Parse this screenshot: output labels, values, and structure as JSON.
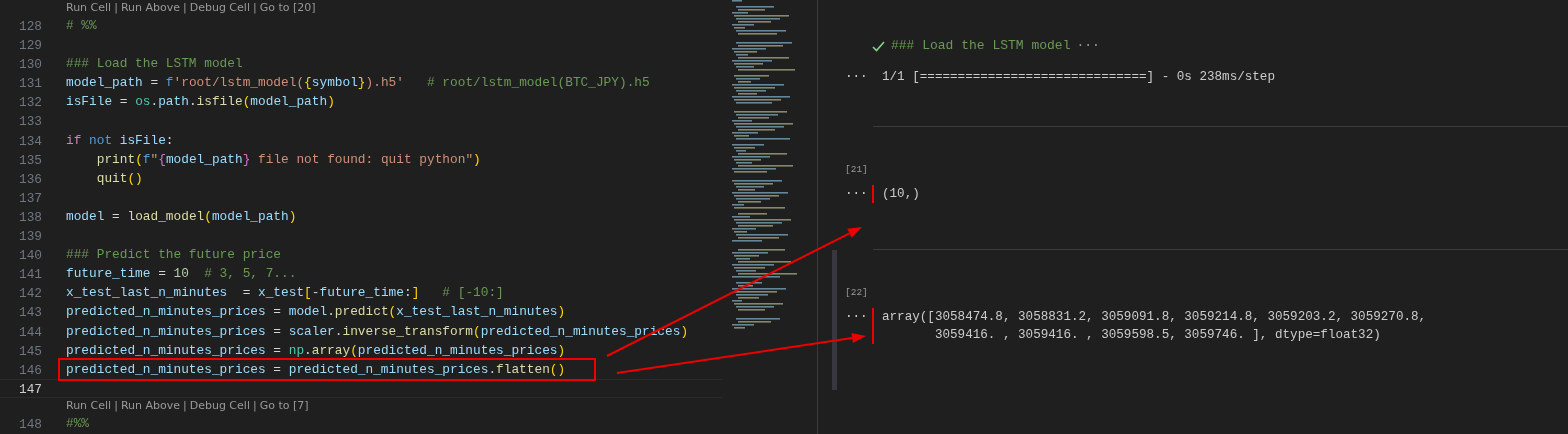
{
  "editor": {
    "lines": [
      {
        "kind": "codelens",
        "links": [
          "Run Cell",
          "Run Above",
          "Debug Cell",
          "Go to [20]"
        ],
        "separator": "|"
      },
      {
        "kind": "code",
        "number": "128",
        "current": false,
        "highlighted": false,
        "tokens": [
          {
            "text": "# %%",
            "kind": "comment"
          }
        ]
      },
      {
        "kind": "code",
        "number": "129",
        "current": false,
        "highlighted": false
      },
      {
        "kind": "code",
        "number": "130",
        "current": false,
        "highlighted": false,
        "tokens": [
          {
            "text": "### Load the LSTM model",
            "kind": "comment"
          }
        ]
      },
      {
        "kind": "code",
        "number": "131",
        "current": false,
        "highlighted": false,
        "tokens": [
          {
            "text": "model_path",
            "kind": "var"
          },
          {
            "text": " = ",
            "kind": "op"
          },
          {
            "text": "f",
            "kind": "keyword"
          },
          {
            "text": "'root/lstm_model(",
            "kind": "string"
          },
          {
            "text": "{",
            "kind": "bracket1"
          },
          {
            "text": "symbol",
            "kind": "var"
          },
          {
            "text": "}",
            "kind": "bracket1"
          },
          {
            "text": ").h5'",
            "kind": "string"
          },
          {
            "text": "   # root/lstm_model(BTC_JPY).h5",
            "kind": "comment"
          }
        ]
      },
      {
        "kind": "code",
        "number": "132",
        "current": false,
        "highlighted": false,
        "tokens": [
          {
            "text": "isFile",
            "kind": "var"
          },
          {
            "text": " = ",
            "kind": "op"
          },
          {
            "text": "os",
            "kind": "module"
          },
          {
            "text": ".",
            "kind": "op"
          },
          {
            "text": "path",
            "kind": "var"
          },
          {
            "text": ".",
            "kind": "op"
          },
          {
            "text": "isfile",
            "kind": "func"
          },
          {
            "text": "(",
            "kind": "bracket1"
          },
          {
            "text": "model_path",
            "kind": "var"
          },
          {
            "text": ")",
            "kind": "bracket1"
          }
        ]
      },
      {
        "kind": "code",
        "number": "133",
        "current": false,
        "highlighted": false
      },
      {
        "kind": "code",
        "number": "134",
        "current": false,
        "highlighted": false,
        "tokens": [
          {
            "text": "if",
            "kind": "control"
          },
          {
            "text": " not",
            "kind": "keyword"
          },
          {
            "text": " isFile",
            "kind": "var"
          },
          {
            "text": ":",
            "kind": "op"
          }
        ]
      },
      {
        "kind": "code",
        "number": "135",
        "current": false,
        "highlighted": false,
        "tokens": [
          {
            "text": "    print",
            "kind": "func"
          },
          {
            "text": "(",
            "kind": "bracket1"
          },
          {
            "text": "f",
            "kind": "keyword"
          },
          {
            "text": "\"",
            "kind": "string"
          },
          {
            "text": "{",
            "kind": "bracket2"
          },
          {
            "text": "model_path",
            "kind": "var"
          },
          {
            "text": "}",
            "kind": "bracket2"
          },
          {
            "text": " file not found: quit python\"",
            "kind": "string"
          },
          {
            "text": ")",
            "kind": "bracket1"
          }
        ]
      },
      {
        "kind": "code",
        "number": "136",
        "current": false,
        "highlighted": false,
        "tokens": [
          {
            "text": "    quit",
            "kind": "func"
          },
          {
            "text": "()",
            "kind": "bracket1"
          }
        ]
      },
      {
        "kind": "code",
        "number": "137",
        "current": false,
        "highlighted": false
      },
      {
        "kind": "code",
        "number": "138",
        "current": false,
        "highlighted": false,
        "tokens": [
          {
            "text": "model",
            "kind": "var"
          },
          {
            "text": " = ",
            "kind": "op"
          },
          {
            "text": "load_model",
            "kind": "func"
          },
          {
            "text": "(",
            "kind": "bracket1"
          },
          {
            "text": "model_path",
            "kind": "var"
          },
          {
            "text": ")",
            "kind": "bracket1"
          }
        ]
      },
      {
        "kind": "code",
        "number": "139",
        "current": false,
        "highlighted": false
      },
      {
        "kind": "code",
        "number": "140",
        "current": false,
        "highlighted": false,
        "tokens": [
          {
            "text": "### Predict the future price",
            "kind": "comment"
          }
        ]
      },
      {
        "kind": "code",
        "number": "141",
        "current": false,
        "highlighted": false,
        "tokens": [
          {
            "text": "future_time",
            "kind": "var"
          },
          {
            "text": " = ",
            "kind": "op"
          },
          {
            "text": "10",
            "kind": "number"
          },
          {
            "text": "  # 3, 5, 7...",
            "kind": "comment"
          }
        ]
      },
      {
        "kind": "code",
        "number": "142",
        "current": false,
        "highlighted": false,
        "tokens": [
          {
            "text": "x_test_last_n_minutes",
            "kind": "var"
          },
          {
            "text": "  = ",
            "kind": "op"
          },
          {
            "text": "x_test",
            "kind": "var"
          },
          {
            "text": "[",
            "kind": "bracket1"
          },
          {
            "text": "-",
            "kind": "op"
          },
          {
            "text": "future_time",
            "kind": "var"
          },
          {
            "text": ":",
            "kind": "op"
          },
          {
            "text": "]",
            "kind": "bracket1"
          },
          {
            "text": "   # [-10:]",
            "kind": "comment"
          }
        ]
      },
      {
        "kind": "code",
        "number": "143",
        "current": false,
        "highlighted": false,
        "tokens": [
          {
            "text": "predicted_n_minutes_prices",
            "kind": "var"
          },
          {
            "text": " = ",
            "kind": "op"
          },
          {
            "text": "model",
            "kind": "var"
          },
          {
            "text": ".",
            "kind": "op"
          },
          {
            "text": "predict",
            "kind": "func"
          },
          {
            "text": "(",
            "kind": "bracket1"
          },
          {
            "text": "x_test_last_n_minutes",
            "kind": "var"
          },
          {
            "text": ")",
            "kind": "bracket1"
          }
        ]
      },
      {
        "kind": "code",
        "number": "144",
        "current": false,
        "highlighted": false,
        "tokens": [
          {
            "text": "predicted_n_minutes_prices",
            "kind": "var"
          },
          {
            "text": " = ",
            "kind": "op"
          },
          {
            "text": "scaler",
            "kind": "var"
          },
          {
            "text": ".",
            "kind": "op"
          },
          {
            "text": "inverse_transform",
            "kind": "func"
          },
          {
            "text": "(",
            "kind": "bracket1"
          },
          {
            "text": "predicted_n_minutes_prices",
            "kind": "var"
          },
          {
            "text": ")",
            "kind": "bracket1"
          }
        ]
      },
      {
        "kind": "code",
        "number": "145",
        "current": false,
        "highlighted": false,
        "tokens": [
          {
            "text": "predicted_n_minutes_prices",
            "kind": "var"
          },
          {
            "text": " = ",
            "kind": "op"
          },
          {
            "text": "np",
            "kind": "module"
          },
          {
            "text": ".",
            "kind": "op"
          },
          {
            "text": "array",
            "kind": "func"
          },
          {
            "text": "(",
            "kind": "bracket1"
          },
          {
            "text": "predicted_n_minutes_prices",
            "kind": "var"
          },
          {
            "text": ")",
            "kind": "bracket1"
          }
        ]
      },
      {
        "kind": "code",
        "number": "146",
        "current": false,
        "highlighted": true,
        "tokens": [
          {
            "text": "predicted_n_minutes_prices",
            "kind": "var"
          },
          {
            "text": " = ",
            "kind": "op"
          },
          {
            "text": "predicted_n_minutes_prices",
            "kind": "var"
          },
          {
            "text": ".",
            "kind": "op"
          },
          {
            "text": "flatten",
            "kind": "func"
          },
          {
            "text": "()",
            "kind": "bracket1"
          }
        ]
      },
      {
        "kind": "code",
        "number": "147",
        "current": true,
        "highlighted": false
      },
      {
        "kind": "codelens",
        "links": [
          "Run Cell",
          "Run Above",
          "Debug Cell",
          "Go to [7]"
        ],
        "separator": "|"
      },
      {
        "kind": "code",
        "number": "148",
        "current": false,
        "highlighted": false,
        "tokens": [
          {
            "text": "#%%",
            "kind": "comment"
          }
        ]
      }
    ]
  },
  "output": {
    "cells": [
      {
        "kind": "markdown",
        "focused": false,
        "marked": false,
        "title": "### Load the LSTM model",
        "more": "···",
        "prompt": "···",
        "text": "1/1 [==============================] - 0s 238ms/step"
      },
      {
        "kind": "code",
        "focused": false,
        "marked": true,
        "count": "[21]",
        "prompt": "···",
        "text": "(10,)"
      },
      {
        "kind": "code",
        "focused": true,
        "marked": true,
        "count": "[22]",
        "prompt": "···",
        "text": "array([3058474.8, 3058831.2, 3059091.8, 3059214.8, 3059203.2, 3059270.8,\n       3059416. , 3059416. , 3059598.5, 3059746. ], dtype=float32)"
      }
    ]
  },
  "annotations": [
    {
      "kind": "arrow"
    },
    {
      "kind": "arrow"
    }
  ]
}
